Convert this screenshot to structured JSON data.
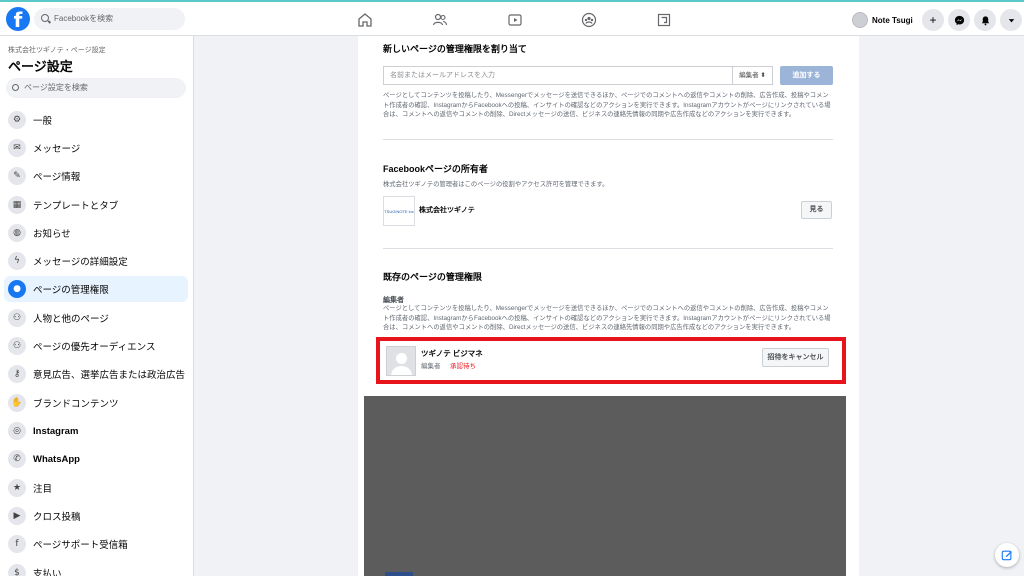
{
  "topbar": {
    "logo": "f",
    "search_placeholder": "Facebookを検索",
    "nav_icons": [
      "home-icon",
      "friends-icon",
      "watch-icon",
      "groups-icon",
      "gaming-icon"
    ],
    "profile_name": "Note Tsugi",
    "actions": [
      "+",
      "messenger-icon",
      "notifications-icon",
      "menu-caret-icon"
    ]
  },
  "sidebar": {
    "breadcrumb": "株式会社ツギノテ・ページ設定",
    "title": "ページ設定",
    "search_placeholder": "ページ設定を検索",
    "items": [
      {
        "label": "一般",
        "icon": "gear-icon",
        "glyph": "⚙"
      },
      {
        "label": "メッセージ",
        "icon": "chat-icon",
        "glyph": "✉"
      },
      {
        "label": "ページ情報",
        "icon": "pencil-icon",
        "glyph": "✎"
      },
      {
        "label": "テンプレートとタブ",
        "icon": "grid-icon",
        "glyph": "▦"
      },
      {
        "label": "お知らせ",
        "icon": "globe-icon",
        "glyph": "◍"
      },
      {
        "label": "メッセージの詳細設定",
        "icon": "messenger-icon",
        "glyph": "ϟ"
      },
      {
        "label": "ページの管理権限",
        "icon": "person-icon",
        "glyph": "●",
        "active": true
      },
      {
        "label": "人物と他のページ",
        "icon": "people-icon",
        "glyph": "⚇"
      },
      {
        "label": "ページの優先オーディエンス",
        "icon": "audience-icon",
        "glyph": "⚇"
      },
      {
        "label": "意見広告、選挙広告または政治広告",
        "icon": "key-icon",
        "glyph": "⚷"
      },
      {
        "label": "ブランドコンテンツ",
        "icon": "handshake-icon",
        "glyph": "✋"
      },
      {
        "label": "Instagram",
        "icon": "instagram-icon",
        "glyph": "◎",
        "bold": true
      },
      {
        "label": "WhatsApp",
        "icon": "whatsapp-icon",
        "glyph": "✆",
        "bold": true
      },
      {
        "label": "注目",
        "icon": "star-icon",
        "glyph": "★"
      },
      {
        "label": "クロス投稿",
        "icon": "video-icon",
        "glyph": "▶"
      },
      {
        "label": "ページサポート受信箱",
        "icon": "facebook-icon",
        "glyph": "f"
      },
      {
        "label": "支払い",
        "icon": "dollar-icon",
        "glyph": "$"
      }
    ]
  },
  "main": {
    "assign_section": {
      "title": "新しいページの管理権限を割り当て",
      "input_placeholder": "名前またはメールアドレスを入力",
      "role_select": "編集者 ⬍",
      "add_button": "追加する",
      "description": "ページとしてコンテンツを投稿したり、Messengerでメッセージを送信できるほか、ページでのコメントへの返信やコメントの削除、広告作成、投稿やコメント作成者の確認、InstagramからFacebookへの投稿、インサイトの確認などのアクションを実行できます。Instagramアカウントがページにリンクされている場合は、コメントへの返信やコメントの削除、Directメッセージの送信、ビジネスの連絡先情報の同期や広告作成などのアクションを実行できます。"
    },
    "owner_section": {
      "title": "Facebookページの所有者",
      "description": "株式会社ツギノテの管理者はこのページの役割やアクセス許可を管理できます。",
      "owner_logo_text": "TSUGINOTE inc",
      "owner_name": "株式会社ツギノテ",
      "view_button": "見る"
    },
    "existing_section": {
      "title": "既存のページの管理権限",
      "role_label": "編集者",
      "description": "ページとしてコンテンツを投稿したり、Messengerでメッセージを送信できるほか、ページでのコメントへの返信やコメントの削除、広告作成、投稿やコメント作成者の確認、InstagramからFacebookへの投稿、インサイトの確認などのアクションを実行できます。Instagramアカウントがページにリンクされている場合は、コメントへの返信やコメントの削除、Directメッセージの送信、ビジネスの連絡先情報の同期や広告作成などのアクションを実行できます。",
      "invitee_name": "ツギノテ ビジマネ",
      "invitee_role": "編集者",
      "invitee_status": "承認待ち",
      "cancel_button": "招待をキャンセル"
    }
  },
  "colors": {
    "brand": "#1877f2",
    "highlight_border": "#e8141c",
    "pending_status": "#e8141c"
  }
}
